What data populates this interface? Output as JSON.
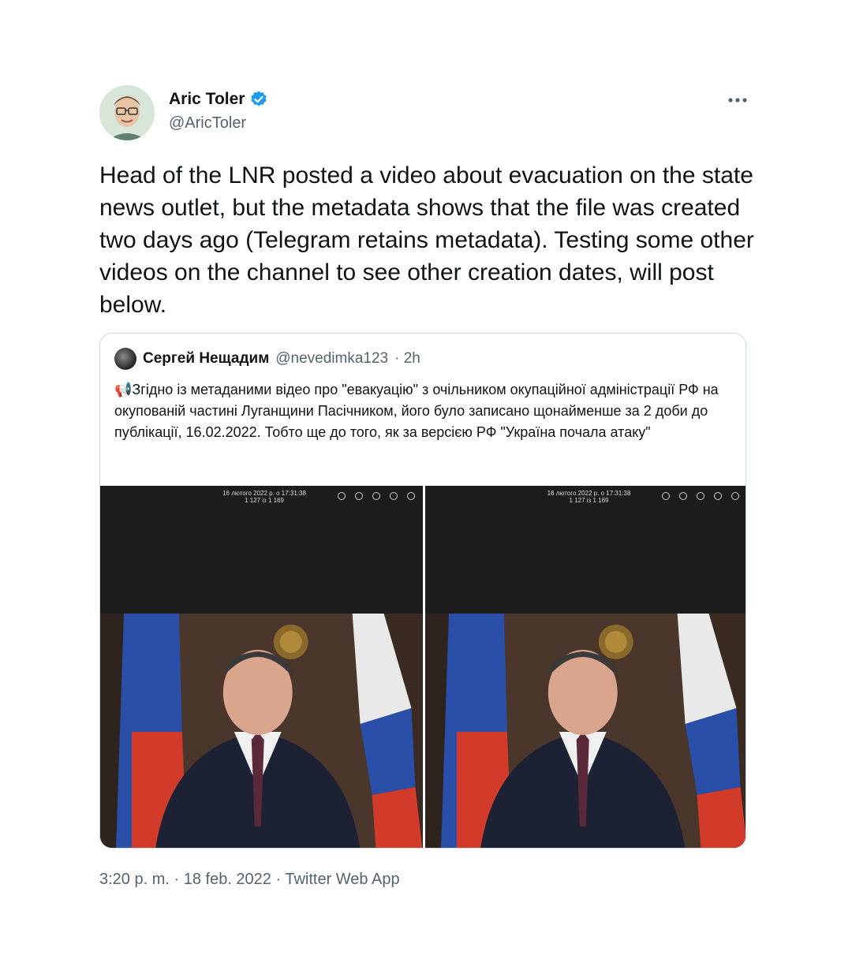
{
  "author": {
    "name": "Aric Toler",
    "handle": "@AricToler"
  },
  "tweet": {
    "text": "Head of the LNR posted a video about evacuation on the state news outlet, but the metadata shows that the file was created two days ago (Telegram retains metadata). Testing some other videos on the channel to see other creation dates, will post below."
  },
  "quoted": {
    "name": "Сергей Нещадим",
    "handle": "@nevedimka123",
    "time": "· 2h",
    "text": "Згідно із метаданими відео про \"евакуацію\" з очільником окупаційної адміністрації РФ на окупованій частині Луганщини Пасічником, його було записано щонайменше за 2 доби до публікації, 16.02.2022. Тобто ще до того, як за версією РФ \"Україна почала атаку\"",
    "media": [
      {
        "stamp_line1": "16 лютого 2022 р. о 17:31:38",
        "stamp_line2": "1 127 із 1 169"
      },
      {
        "stamp_line1": "16 лютого 2022 р. о 17:31:38",
        "stamp_line2": "1 127 із 1 169"
      }
    ]
  },
  "footer": {
    "meta": "3:20 p. m. · 18 feb. 2022 · Twitter Web App"
  },
  "colors": {
    "verified": "#1d9bf0",
    "secondary_text": "#536471",
    "border": "#cfd9de"
  },
  "icons": {
    "verified": "verified-badge-icon",
    "more": "more-options-icon",
    "megaphone": "megaphone-icon"
  }
}
